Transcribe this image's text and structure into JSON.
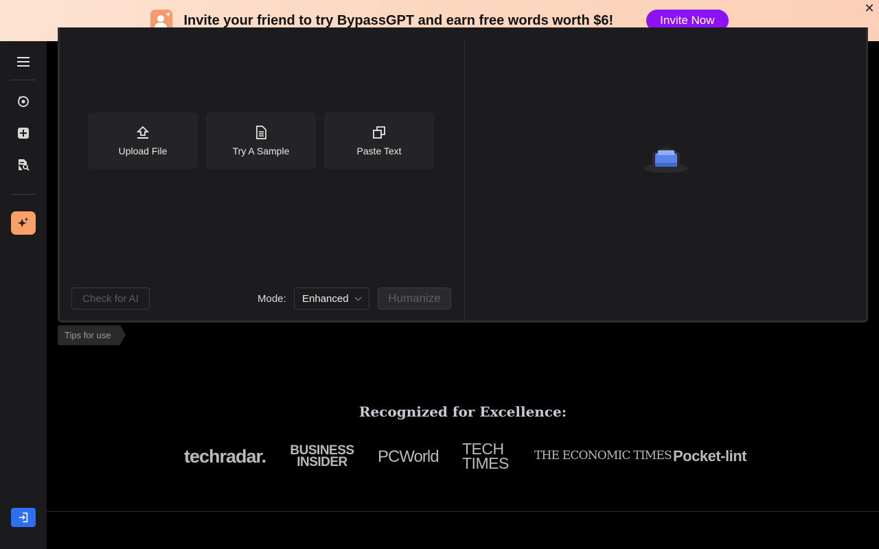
{
  "banner": {
    "text": "Invite your friend to try BypassGPT and earn free words worth $6!",
    "button": "Invite Now",
    "close": "✕"
  },
  "sidebar": {
    "items": [
      {
        "icon": "menu-icon"
      },
      {
        "icon": "rewrite-icon"
      },
      {
        "icon": "add-icon"
      },
      {
        "icon": "doc-search-icon"
      },
      {
        "icon": "sparkle-icon",
        "active": true
      },
      {
        "icon": "login-icon"
      }
    ]
  },
  "editor": {
    "actions": [
      {
        "label": "Upload File",
        "icon": "upload-icon"
      },
      {
        "label": "Try A Sample",
        "icon": "document-icon"
      },
      {
        "label": "Paste Text",
        "icon": "copy-icon"
      }
    ],
    "check_button": "Check for AI",
    "mode_label": "Mode:",
    "mode_value": "Enhanced",
    "humanize_button": "Humanize"
  },
  "tips": "Tips for use",
  "recognition": {
    "title": "Recognized for Excellence:",
    "logos": [
      "techradar.",
      "BUSINESS INSIDER",
      "PCWorld",
      "TECH TIMES",
      "THE ECONOMIC TIMES",
      "Pocket-lint"
    ]
  },
  "colors": {
    "accent": "#8c12f5",
    "active_tool": "#f9a066",
    "login": "#2e6ff2"
  }
}
